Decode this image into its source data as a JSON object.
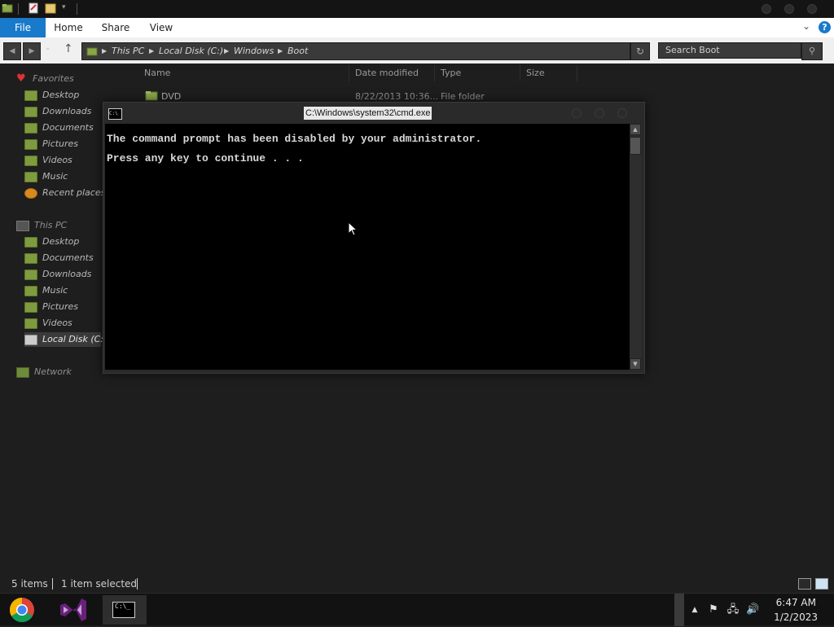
{
  "ribbon": {
    "tabs": [
      "File",
      "Home",
      "Share",
      "View"
    ],
    "help_label": "?"
  },
  "nav": {
    "breadcrumb": [
      "This PC",
      "Local Disk (C:)",
      "Windows",
      "Boot"
    ],
    "search_placeholder": "Search Boot"
  },
  "sidebar": {
    "favorites_label": "Favorites",
    "favorites": [
      "Desktop",
      "Downloads",
      "Documents",
      "Pictures",
      "Videos",
      "Music",
      "Recent places"
    ],
    "thispc_label": "This PC",
    "thispc": [
      "Desktop",
      "Documents",
      "Downloads",
      "Music",
      "Pictures",
      "Videos",
      "Local Disk (C:)"
    ],
    "network_label": "Network"
  },
  "file_list": {
    "columns": [
      "Name",
      "Date modified",
      "Type",
      "Size"
    ],
    "rows": [
      {
        "name": "DVD",
        "date": "8/22/2013 10:36...",
        "type": "File folder",
        "size": ""
      }
    ]
  },
  "cmd": {
    "title": "C:\\Windows\\system32\\cmd.exe",
    "icon_text": "C:\\",
    "lines": [
      "The command prompt has been disabled by your administrator.",
      "Press any key to continue . . ."
    ]
  },
  "status": {
    "items_count": "5 items",
    "selected": "1 item selected"
  },
  "taskbar": {
    "apps": [
      "chrome-icon",
      "visual-studio-icon",
      "cmd-icon"
    ],
    "cmd_icon_text": "C:\\_",
    "time": "6:47 AM",
    "date": "1/2/2023"
  },
  "colors": {
    "accent": "#1979ca",
    "console_bg": "#000000",
    "explorer_bg": "#1e1e1e"
  }
}
